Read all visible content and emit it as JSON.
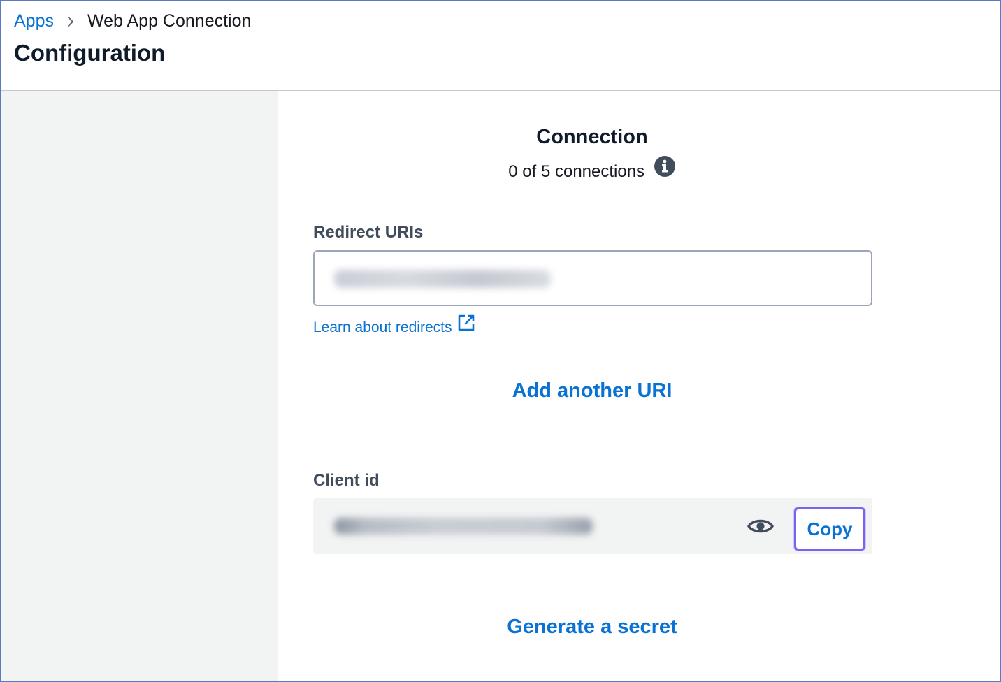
{
  "breadcrumb": {
    "root": "Apps",
    "current": "Web App Connection"
  },
  "page": {
    "title": "Configuration"
  },
  "connection": {
    "title": "Connection",
    "count_text": "0 of 5 connections"
  },
  "redirect": {
    "label": "Redirect URIs",
    "learn_link": "Learn about redirects",
    "add_button": "Add another URI"
  },
  "client": {
    "label": "Client id",
    "copy_button": "Copy"
  },
  "secret": {
    "generate_button": "Generate a secret"
  },
  "icons": {
    "separator": "chevron-right-icon",
    "info": "info-icon",
    "external": "external-link-icon",
    "visibility": "eye-icon"
  },
  "colors": {
    "link": "#0972d3",
    "focus_ring": "#7a63f1",
    "frame": "#5b78c9"
  }
}
